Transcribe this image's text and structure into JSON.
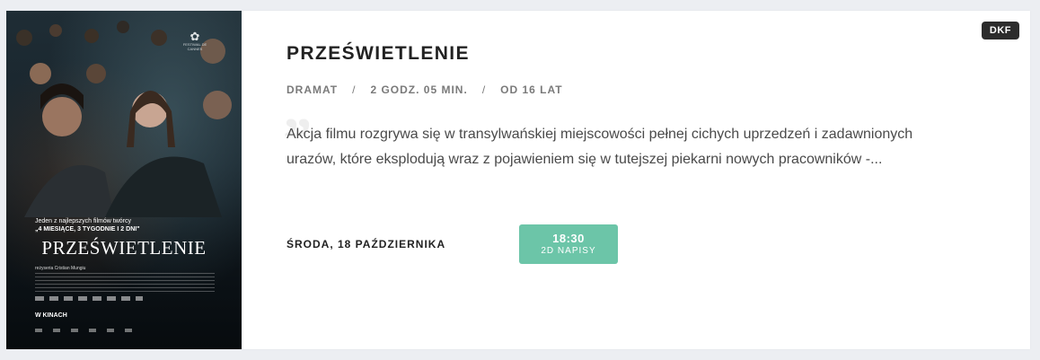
{
  "movie": {
    "badge": "DKF",
    "title": "PRZEŚWIETLENIE",
    "genre": "DRAMAT",
    "duration": "2 GODZ. 05 MIN.",
    "age_rating": "OD 16 LAT",
    "separator": "/",
    "description": "Akcja filmu rozgrywa się w transylwańskiej miejscowości pełnej cichych uprzedzeń i zadawnionych urazów, które eksplodują wraz z pojawieniem się w tutejszej piekarni nowych pracowników -...",
    "date_label": "ŚRODA, 18 PAŹDZIERNIKA",
    "showtimes": [
      {
        "time": "18:30",
        "format": "2D NAPISY"
      }
    ]
  },
  "poster": {
    "festival": "FESTIWAL DE CANNES",
    "tagline_line1": "Jeden z najlepszych filmów twórcy",
    "tagline_line2": "„4 MIESIĄCE, 3 TYGODNIE I 2 DNI\"",
    "title": "PRZEŚWIETLENIE",
    "director": "reżyseria Cristian Mungiu",
    "release": "W KINACH"
  },
  "colors": {
    "showtime_button": "#6cc5a8",
    "badge_bg": "#2c2c2c",
    "page_bg": "#eceef2"
  }
}
